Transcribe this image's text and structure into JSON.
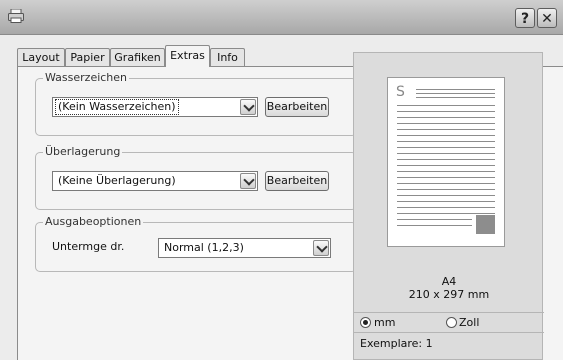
{
  "window": {
    "help_label": "?",
    "close_label": "✕"
  },
  "tabs": [
    {
      "label": "Layout"
    },
    {
      "label": "Papier"
    },
    {
      "label": "Grafiken"
    },
    {
      "label": "Extras",
      "active": true
    },
    {
      "label": "Info"
    }
  ],
  "watermark": {
    "group_title": "Wasserzeichen",
    "selected": "(Kein Wasserzeichen)",
    "edit_label": "Bearbeiten"
  },
  "overlay": {
    "group_title": "Überlagerung",
    "selected": "(Keine Überlagerung)",
    "edit_label": "Bearbeiten"
  },
  "output": {
    "group_title": "Ausgabeoptionen",
    "label": "Untermge dr.",
    "selected": "Normal (1,2,3)"
  },
  "preview": {
    "paper_letter": "S",
    "size_name": "A4",
    "size_dims": "210 x 297 mm",
    "units": [
      {
        "label": "mm",
        "selected": true
      },
      {
        "label": "Zoll",
        "selected": false
      }
    ],
    "copies": "Exemplare: 1"
  }
}
